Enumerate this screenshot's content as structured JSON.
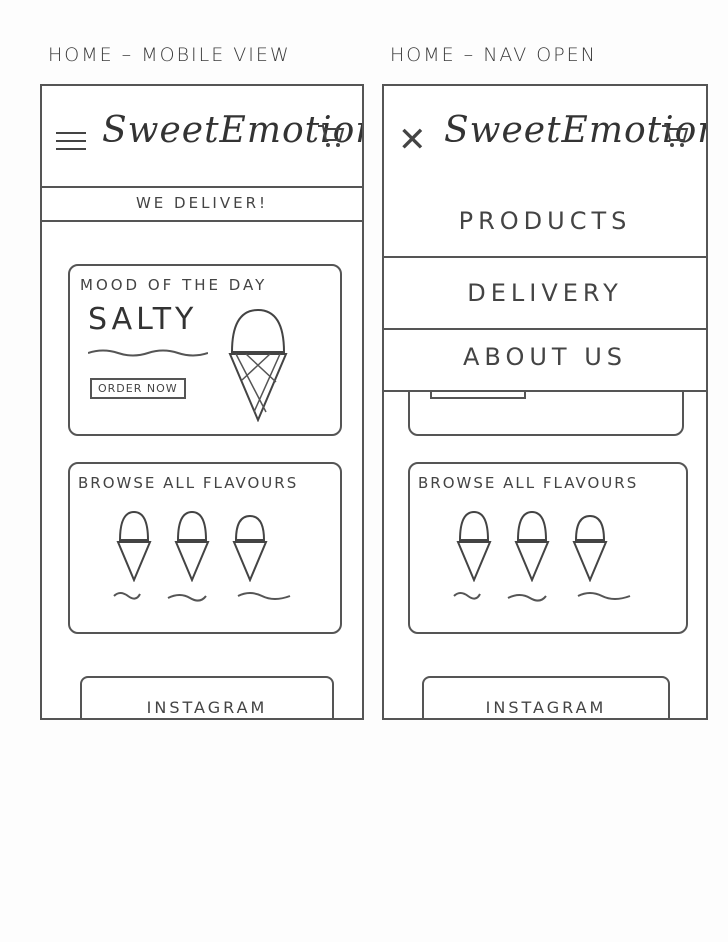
{
  "titles": {
    "left": "HOME – MOBILE VIEW",
    "right": "HOME – NAV OPEN"
  },
  "header": {
    "logo": "SweetEmotion"
  },
  "banner": {
    "text": "WE DELIVER!"
  },
  "mood_card": {
    "heading": "MOOD OF THE DAY",
    "flavour": "SALTY",
    "button": "ORDER NOW"
  },
  "browse_card": {
    "heading": "BROWSE ALL FLAVOURS"
  },
  "instagram": {
    "label": "INSTAGRAM"
  },
  "nav": {
    "items": [
      {
        "label": "PRODUCTS"
      },
      {
        "label": "DELIVERY"
      },
      {
        "label": "ABOUT US"
      }
    ]
  },
  "colors": {
    "ink": "#444444",
    "paper": "#fdfdfd"
  },
  "icons": {
    "menu": "hamburger-icon",
    "close": "close-icon",
    "cart": "cart-icon"
  }
}
